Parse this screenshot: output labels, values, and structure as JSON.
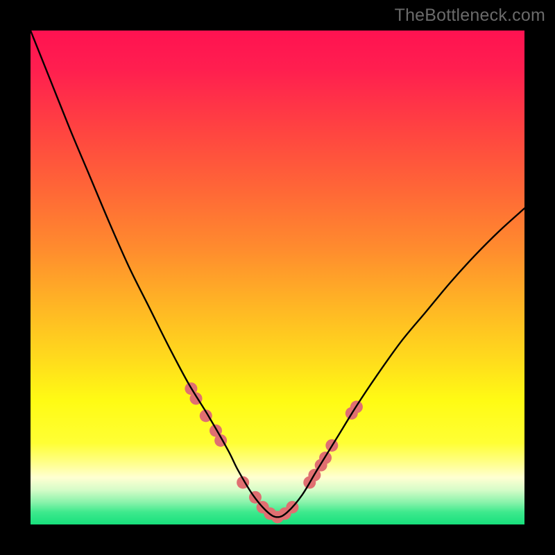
{
  "watermark": "TheBottleneck.com",
  "chart_data": {
    "type": "line",
    "title": "",
    "xlabel": "",
    "ylabel": "",
    "xlim": [
      0,
      100
    ],
    "ylim": [
      0,
      100
    ],
    "grid": false,
    "series": [
      {
        "name": "bottleneck-curve",
        "x": [
          0,
          4,
          8,
          12,
          16,
          20,
          24,
          28,
          32,
          36,
          40,
          42,
          45,
          48,
          50,
          52,
          55,
          58,
          62,
          66,
          70,
          75,
          80,
          85,
          90,
          95,
          100
        ],
        "y": [
          100,
          90,
          80,
          70.5,
          61,
          52,
          44,
          36,
          28.5,
          22,
          15,
          11,
          6,
          2.5,
          1.5,
          2.5,
          6,
          11,
          17.5,
          24,
          30,
          37,
          43,
          49,
          54.5,
          59.5,
          64
        ]
      }
    ],
    "markers": {
      "name": "highlight-dots",
      "color": "#e06f71",
      "radius_px": 9,
      "points_xy": [
        [
          32.5,
          27.5
        ],
        [
          33.5,
          25.5
        ],
        [
          35.5,
          22
        ],
        [
          37.5,
          19
        ],
        [
          38.5,
          17
        ],
        [
          43,
          8.5
        ],
        [
          45.5,
          5.5
        ],
        [
          47,
          3.5
        ],
        [
          48.5,
          2.2
        ],
        [
          50,
          1.5
        ],
        [
          51.5,
          2.2
        ],
        [
          53,
          3.5
        ],
        [
          56.5,
          8.5
        ],
        [
          57.5,
          10
        ],
        [
          58.8,
          12
        ],
        [
          59.7,
          13.5
        ],
        [
          61,
          16
        ],
        [
          65,
          22.5
        ],
        [
          66,
          23.8
        ]
      ]
    },
    "gradient_stops": [
      {
        "offset": 0.0,
        "color": "#ff1251"
      },
      {
        "offset": 0.08,
        "color": "#ff1f4f"
      },
      {
        "offset": 0.2,
        "color": "#ff4341"
      },
      {
        "offset": 0.32,
        "color": "#ff6637"
      },
      {
        "offset": 0.44,
        "color": "#ff8b2e"
      },
      {
        "offset": 0.55,
        "color": "#ffb325"
      },
      {
        "offset": 0.66,
        "color": "#ffd91d"
      },
      {
        "offset": 0.75,
        "color": "#fffb14"
      },
      {
        "offset": 0.835,
        "color": "#ffff34"
      },
      {
        "offset": 0.875,
        "color": "#ffff8a"
      },
      {
        "offset": 0.905,
        "color": "#ffffd2"
      },
      {
        "offset": 0.93,
        "color": "#d6fcc8"
      },
      {
        "offset": 0.955,
        "color": "#8af3ab"
      },
      {
        "offset": 0.975,
        "color": "#3ee98d"
      },
      {
        "offset": 1.0,
        "color": "#17e07c"
      }
    ]
  }
}
